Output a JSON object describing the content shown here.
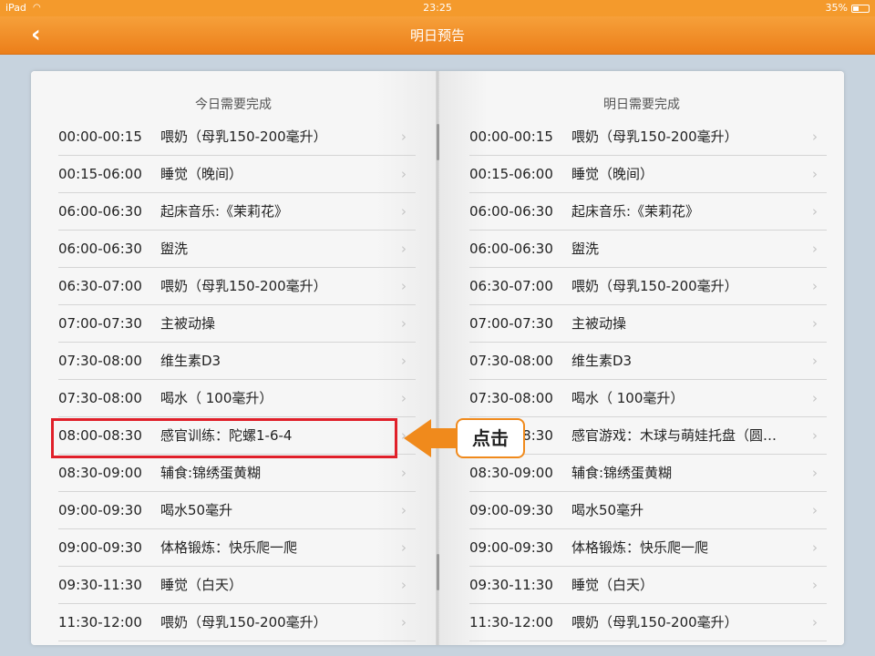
{
  "status_bar": {
    "carrier": "iPad",
    "time": "23:25",
    "battery": "35%",
    "wifi_icon": "wifi-icon"
  },
  "nav": {
    "title": "明日预告",
    "back_icon": "‹"
  },
  "left_page": {
    "title": "今日需要完成",
    "rows": [
      {
        "time": "00:00-00:15",
        "task": "喂奶（母乳150-200毫升）"
      },
      {
        "time": "00:15-06:00",
        "task": "睡觉（晚间）"
      },
      {
        "time": "06:00-06:30",
        "task": "起床音乐:《茉莉花》"
      },
      {
        "time": "06:00-06:30",
        "task": "盥洗"
      },
      {
        "time": "06:30-07:00",
        "task": "喂奶（母乳150-200毫升）"
      },
      {
        "time": "07:00-07:30",
        "task": "主被动操"
      },
      {
        "time": "07:30-08:00",
        "task": "维生素D3"
      },
      {
        "time": "07:30-08:00",
        "task": "喝水（ 100毫升）"
      },
      {
        "time": "08:00-08:30",
        "task": "感官训练：陀螺1-6-4"
      },
      {
        "time": "08:30-09:00",
        "task": "辅食:锦绣蛋黄糊"
      },
      {
        "time": "09:00-09:30",
        "task": "喝水50毫升"
      },
      {
        "time": "09:00-09:30",
        "task": "体格锻炼：快乐爬一爬"
      },
      {
        "time": "09:30-11:30",
        "task": "睡觉（白天）"
      },
      {
        "time": "11:30-12:00",
        "task": "喂奶（母乳150-200毫升）"
      }
    ]
  },
  "right_page": {
    "title": "明日需要完成",
    "rows": [
      {
        "time": "00:00-00:15",
        "task": "喂奶（母乳150-200毫升）"
      },
      {
        "time": "00:15-06:00",
        "task": "睡觉（晚间）"
      },
      {
        "time": "06:00-06:30",
        "task": "起床音乐:《茉莉花》"
      },
      {
        "time": "06:00-06:30",
        "task": "盥洗"
      },
      {
        "time": "06:30-07:00",
        "task": "喂奶（母乳150-200毫升）"
      },
      {
        "time": "07:00-07:30",
        "task": "主被动操"
      },
      {
        "time": "07:30-08:00",
        "task": "维生素D3"
      },
      {
        "time": "07:30-08:00",
        "task": "喝水（ 100毫升）"
      },
      {
        "time": "08:00-08:30",
        "task": "感官游戏：木球与萌娃托盘（圆…"
      },
      {
        "time": "08:30-09:00",
        "task": "辅食:锦绣蛋黄糊"
      },
      {
        "time": "09:00-09:30",
        "task": "喝水50毫升"
      },
      {
        "time": "09:00-09:30",
        "task": "体格锻炼：快乐爬一爬"
      },
      {
        "time": "09:30-11:30",
        "task": "睡觉（白天）"
      },
      {
        "time": "11:30-12:00",
        "task": "喂奶（母乳150-200毫升）"
      }
    ]
  },
  "annotation": {
    "click_label": "点击"
  },
  "colors": {
    "nav_orange": "#ec7f1a",
    "highlight_red": "#e0202a",
    "arrow_orange": "#f08a1c"
  }
}
